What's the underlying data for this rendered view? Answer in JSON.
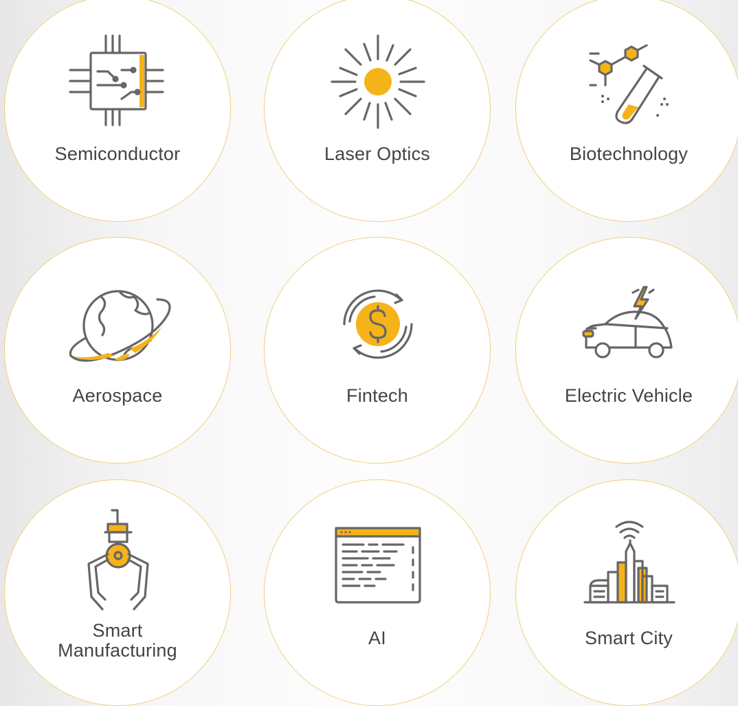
{
  "colors": {
    "icon_stroke": "#666666",
    "accent": "#f5b319",
    "circle_border": "#f0cf79",
    "label_text": "#444444"
  },
  "industries": [
    {
      "label": "Semiconductor",
      "icon": "chip-icon"
    },
    {
      "label": "Laser Optics",
      "icon": "sun-burst-icon"
    },
    {
      "label": "Biotechnology",
      "icon": "test-tube-molecule-icon"
    },
    {
      "label": "Aerospace",
      "icon": "planet-icon"
    },
    {
      "label": "Fintech",
      "icon": "dollar-cycle-icon"
    },
    {
      "label": "Electric Vehicle",
      "icon": "electric-car-icon"
    },
    {
      "label_lines": [
        "Smart",
        "Manufacturing"
      ],
      "icon": "robotic-claw-icon"
    },
    {
      "label": "AI",
      "icon": "code-window-icon"
    },
    {
      "label": "Smart City",
      "icon": "city-wifi-icon"
    }
  ]
}
